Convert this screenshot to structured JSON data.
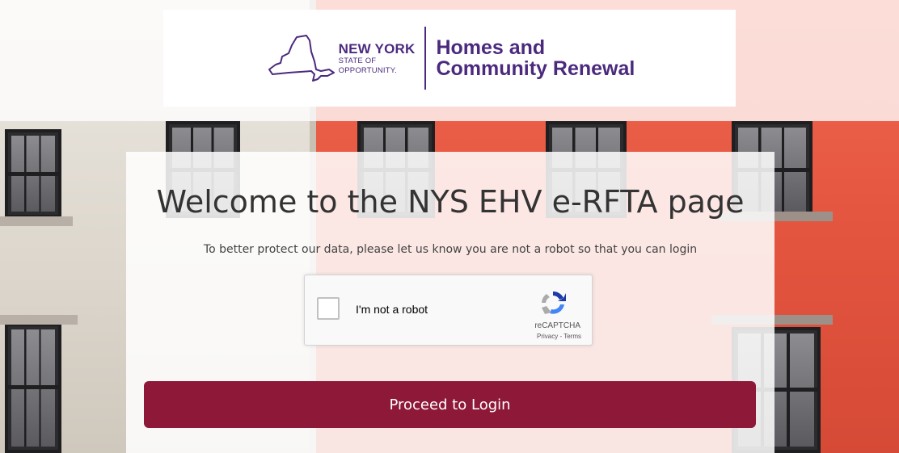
{
  "header": {
    "state_name": "NEW YORK",
    "state_tagline_line1": "STATE OF",
    "state_tagline_line2": "OPPORTUNITY.",
    "agency_line1": "Homes and",
    "agency_line2": "Community Renewal",
    "brand_color": "#4b2a7e"
  },
  "main": {
    "title": "Welcome to the NYS EHV e-RFTA page",
    "subtitle": "To better protect our data, please let us know you are not a robot so that you can login"
  },
  "recaptcha": {
    "checkbox_label": "I'm not a robot",
    "brand": "reCAPTCHA",
    "privacy_link": "Privacy",
    "separator": " - ",
    "terms_link": "Terms",
    "checked": false
  },
  "actions": {
    "proceed_label": "Proceed to Login",
    "proceed_color": "#8e1838"
  },
  "icons": {
    "state_logo": "new-york-state-outline-icon",
    "recaptcha_logo": "recaptcha-logo-icon"
  }
}
